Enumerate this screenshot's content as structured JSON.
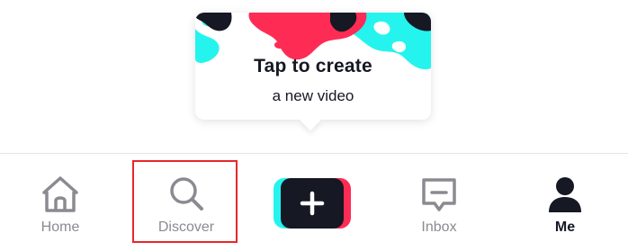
{
  "tooltip": {
    "title": "Tap to create",
    "subtitle": "a new video"
  },
  "tabbar": {
    "items": [
      {
        "label": "Home",
        "icon": "home-icon"
      },
      {
        "label": "Discover",
        "icon": "search-icon"
      },
      {
        "label": "",
        "icon": "plus-icon"
      },
      {
        "label": "Inbox",
        "icon": "message-icon"
      },
      {
        "label": "Me",
        "icon": "profile-icon"
      }
    ],
    "active": "Me",
    "highlighted": "Discover"
  },
  "colors": {
    "brand_cyan": "#25f4ee",
    "brand_red": "#fe2c55",
    "dark": "#161823",
    "inactive": "#8a8b91",
    "highlight": "#e8262b"
  }
}
